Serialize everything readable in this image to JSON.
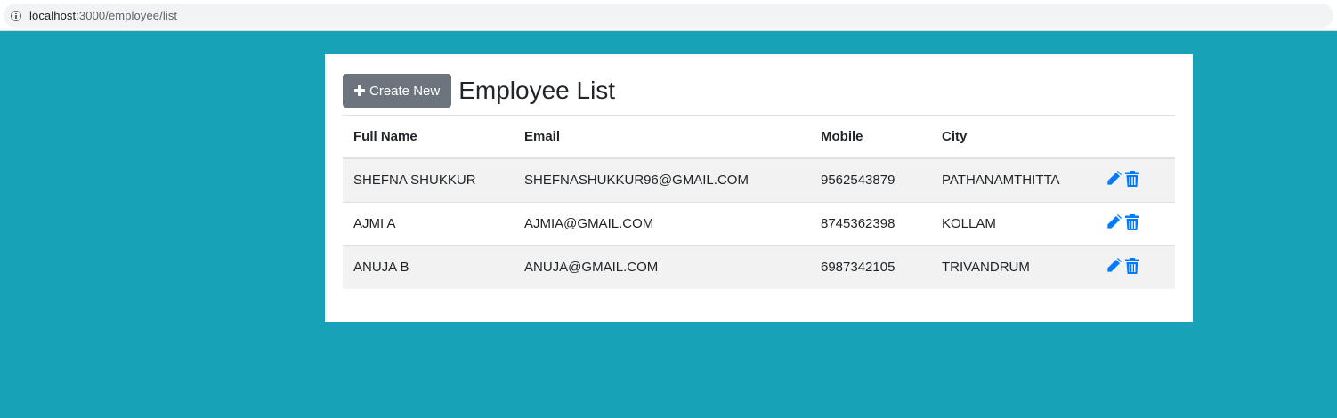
{
  "browser": {
    "url_host": "localhost",
    "url_path": ":3000/employee/list"
  },
  "card": {
    "create_button_label": "Create New",
    "title": "Employee List"
  },
  "table": {
    "headers": [
      "Full Name",
      "Email",
      "Mobile",
      "City",
      ""
    ],
    "rows": [
      {
        "full_name": "SHEFNA SHUKKUR",
        "email": "SHEFNASHUKKUR96@GMAIL.COM",
        "mobile": "9562543879",
        "city": "PATHANAMTHITTA"
      },
      {
        "full_name": "AJMI A",
        "email": "AJMIA@GMAIL.COM",
        "mobile": "8745362398",
        "city": "KOLLAM"
      },
      {
        "full_name": "ANUJA B",
        "email": "ANUJA@GMAIL.COM",
        "mobile": "6987342105",
        "city": "TRIVANDRUM"
      }
    ]
  },
  "icons": {
    "info": "info-icon",
    "plus": "plus-icon",
    "edit": "pencil-icon",
    "delete": "trash-icon"
  },
  "colors": {
    "page_background": "#17a2b8",
    "button_secondary": "#6c757d",
    "action_icon": "#007bff",
    "stripe_row": "#f2f2f2"
  }
}
